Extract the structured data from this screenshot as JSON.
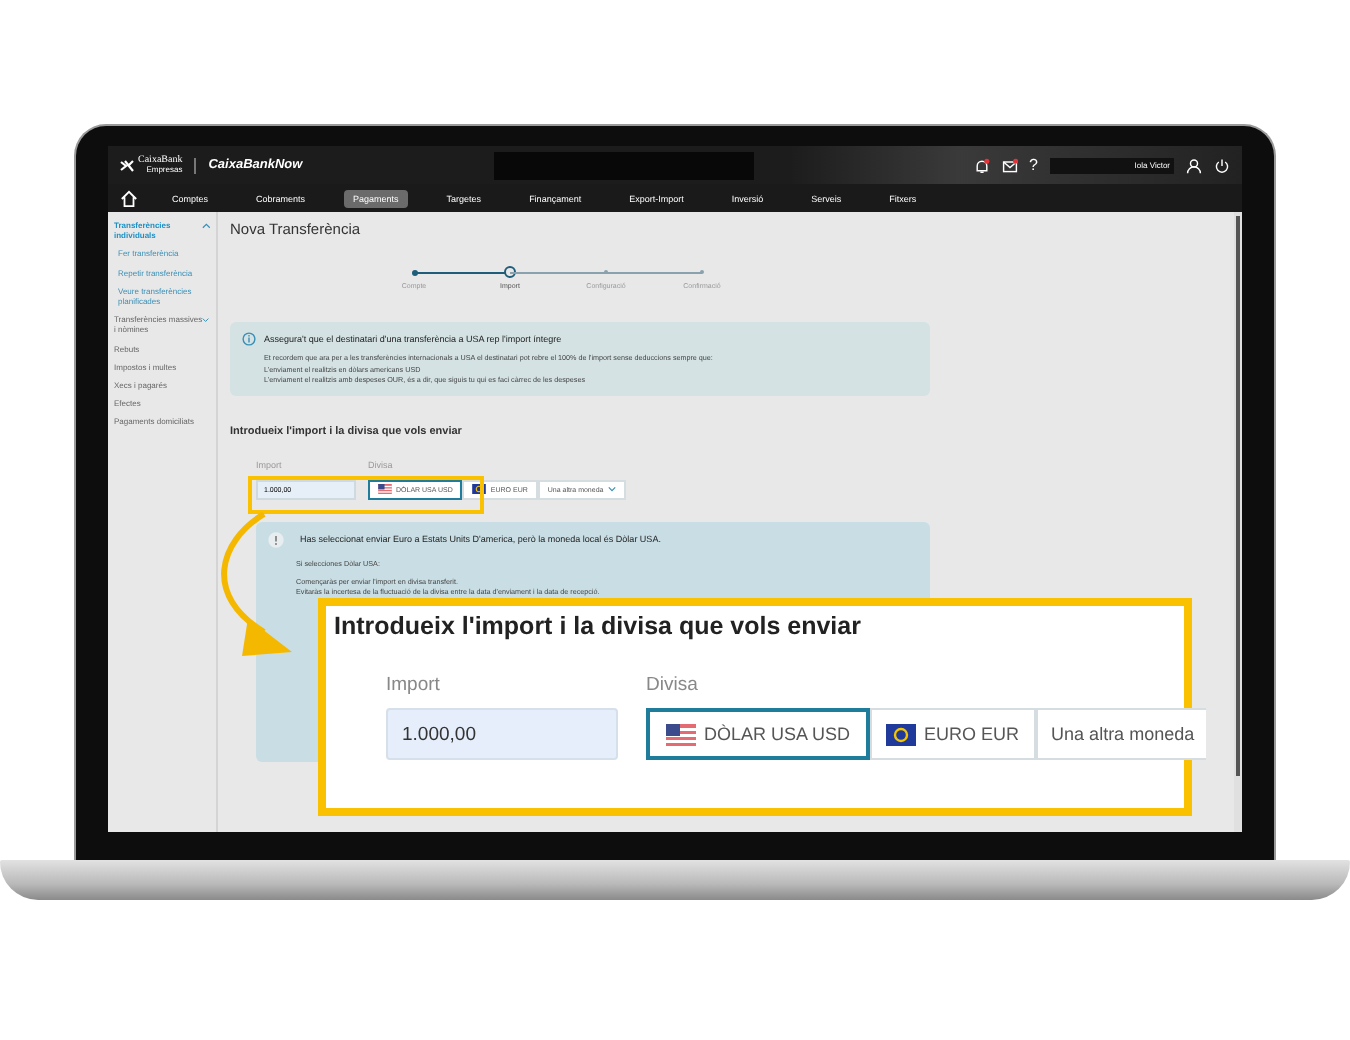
{
  "header": {
    "logo": "CaixaBank",
    "logo_sub": "Empresas",
    "product": "CaixaBankNow",
    "help": "?",
    "user": "Iola Victor"
  },
  "nav": [
    {
      "kind": "home"
    },
    {
      "label": "Comptes",
      "selected": false
    },
    {
      "label": "Cobraments",
      "selected": false
    },
    {
      "label": "Pagaments",
      "selected": true
    },
    {
      "label": "Targetes",
      "selected": false
    },
    {
      "label": "Finançament",
      "selected": false
    },
    {
      "label": "Export-Import",
      "selected": false
    },
    {
      "label": "Inversió",
      "selected": false
    },
    {
      "label": "Serveis",
      "selected": false
    },
    {
      "label": "Fitxers",
      "selected": false
    }
  ],
  "sidebar": {
    "items": [
      {
        "label": "Transferències individuals",
        "selected": true,
        "expanded": true,
        "children": [
          {
            "label": "Fer transferència",
            "selected": false
          },
          {
            "label": "Repetir transferència",
            "selected": false
          },
          {
            "label": "Veure transferències planificades",
            "selected": false
          }
        ]
      },
      {
        "label": "Transferències massives i nòmines",
        "selected": false,
        "expanded": false
      },
      {
        "label": "Rebuts",
        "selected": false
      },
      {
        "label": "Impostos i multes",
        "selected": false
      },
      {
        "label": "Xecs i pagarés",
        "selected": false
      },
      {
        "label": "Efectes",
        "selected": false
      },
      {
        "label": "Pagaments domiciliats",
        "selected": false
      }
    ]
  },
  "page_title": "Nova Transferència",
  "steps": [
    {
      "label": "Compte",
      "completed": true,
      "selected": false
    },
    {
      "label": "Import",
      "completed": false,
      "selected": true
    },
    {
      "label": "Configuració",
      "completed": false,
      "selected": false
    },
    {
      "label": "Confirmació",
      "completed": false,
      "selected": false
    }
  ],
  "info_box": {
    "title": "Assegura't que el destinatari d'una transferència a USA rep l'import íntegre",
    "text": "Et recordem que ara per a les transferències internacionals a USA el destinatari pot rebre el 100% de l'import sense deduccions sempre que:",
    "bullets": [
      "L'enviament el realitzis en dòlars americans USD",
      "L'enviament el realitzis amb despeses OUR, és a dir, que siguis tu qui es faci càrrec de les despeses"
    ]
  },
  "form": {
    "heading": "Introdueix l'import i la divisa que vols enviar",
    "amount_label": "Import",
    "amount": "1.000,00",
    "currency_label": "Divisa",
    "currencies": [
      {
        "kind": "usd",
        "label": "DÒLAR USA USD",
        "selected": true
      },
      {
        "kind": "eur",
        "label": "EURO EUR",
        "selected": false
      },
      {
        "kind": "other",
        "label": "Una altra moneda",
        "selected": false
      }
    ]
  },
  "warning_box": {
    "title": "Has seleccionat enviar Euro a Estats Units D'america, però la moneda local és Dòlar USA.",
    "text": "Si selecciones Dòlar USA:",
    "bullets": [
      "Començaràs per enviar l'import en divisa transferit.",
      "Evitaràs la incertesa de la fluctuació de la divisa entre la data d'enviament i la data de recepció."
    ]
  },
  "callout": {
    "heading": "Introdueix l'import i la divisa que vols enviar",
    "amount_label": "Import",
    "amount": "1.000,00",
    "currency_label": "Divisa",
    "currencies": [
      {
        "kind": "usd",
        "label": "DÒLAR USA USD",
        "selected": true
      },
      {
        "kind": "eur",
        "label": "EURO EUR",
        "selected": false
      },
      {
        "kind": "other",
        "label": "Una altra moneda",
        "selected": false
      }
    ]
  }
}
